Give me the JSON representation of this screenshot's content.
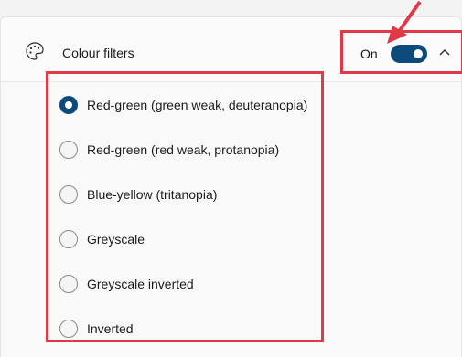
{
  "setting": {
    "icon": "palette-icon",
    "label": "Colour filters",
    "state_label": "On",
    "toggle_on": true,
    "expand_icon": "chevron-up-icon"
  },
  "filter_options": [
    {
      "label": "Red-green (green weak, deuteranopia)",
      "selected": true
    },
    {
      "label": "Red-green (red weak, protanopia)",
      "selected": false
    },
    {
      "label": "Blue-yellow (tritanopia)",
      "selected": false
    },
    {
      "label": "Greyscale",
      "selected": false
    },
    {
      "label": "Greyscale inverted",
      "selected": false
    },
    {
      "label": "Inverted",
      "selected": false
    }
  ],
  "colors": {
    "accent": "#0b4a7a",
    "highlight": "#e03a48"
  }
}
